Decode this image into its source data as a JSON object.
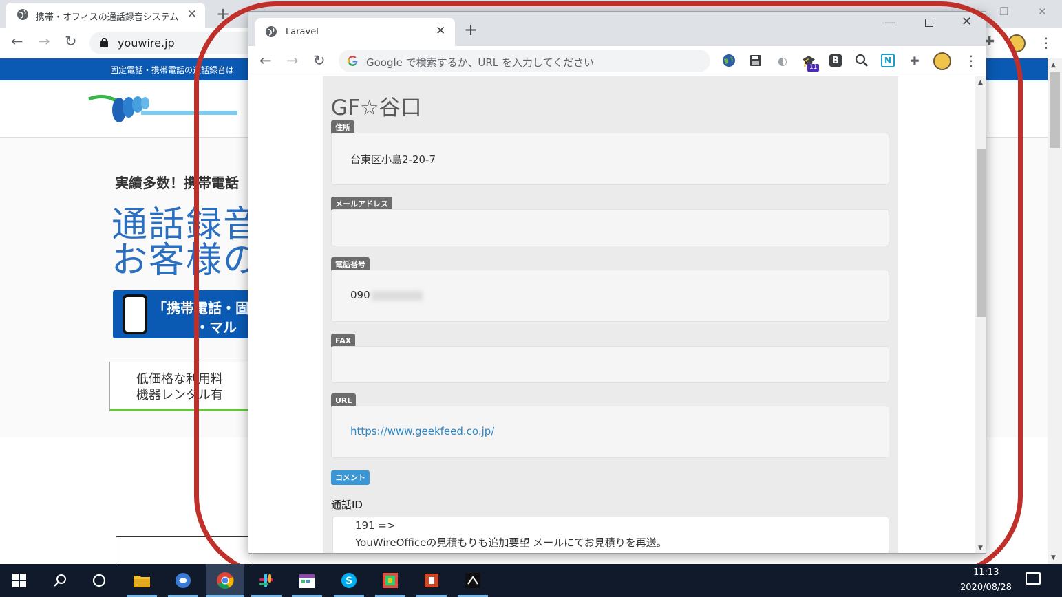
{
  "background_browser": {
    "tab_title": "携帯・オフィスの通話録音システム「Yo",
    "url": "youwire.jp",
    "banner_text": "固定電話・携帯電話の通話録音は",
    "catch_copy": "実績多数！携帯電話",
    "hero_line1": "通話録音",
    "hero_line2": "お客様の",
    "blue_button_line1": "「携帯電話・固",
    "blue_button_line2": "・マル",
    "callout_line1": "低価格な利用料",
    "callout_line2": "機器レンタル有"
  },
  "window": {
    "tab_title": "Laravel",
    "omnibox_placeholder": "Google で検索するか、URL を入力してください",
    "extension_badge": "11"
  },
  "page": {
    "company_name": "GF☆谷口",
    "fields": {
      "address": {
        "label": "住所",
        "value": "台東区小島2-20-7"
      },
      "email": {
        "label": "メールアドレス",
        "value": ""
      },
      "phone": {
        "label": "電話番号",
        "value": "090"
      },
      "fax": {
        "label": "FAX",
        "value": ""
      },
      "url": {
        "label": "URL",
        "value": "https://www.geekfeed.co.jp/"
      }
    },
    "comment_label": "コメント",
    "call_id_label": "通話ID",
    "comment_line1": "191 =>",
    "comment_line2": "YouWireOfficeの見積もりも追加要望 メールにてお見積りを再送。"
  },
  "taskbar": {
    "time": "11:13",
    "date": "2020/08/28"
  },
  "colors": {
    "annotation_red": "#c0302b",
    "label_gray": "#6c6c6c",
    "label_blue": "#3a96d4",
    "link_blue": "#2a87c8",
    "banner_blue": "#0a5ab4"
  }
}
